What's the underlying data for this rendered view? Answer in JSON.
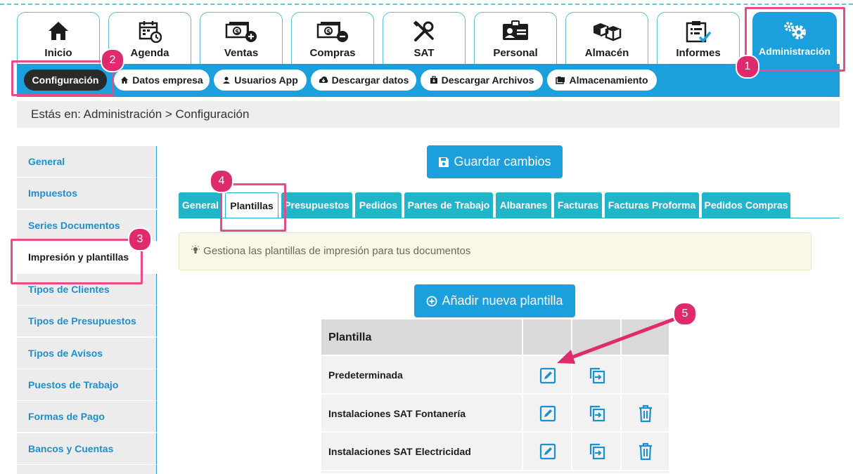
{
  "top_nav": {
    "tabs": [
      {
        "label": "Inicio",
        "icon": "home-icon"
      },
      {
        "label": "Agenda",
        "icon": "calendar-icon"
      },
      {
        "label": "Ventas",
        "icon": "money-plus-icon"
      },
      {
        "label": "Compras",
        "icon": "money-minus-icon"
      },
      {
        "label": "SAT",
        "icon": "tools-icon"
      },
      {
        "label": "Personal",
        "icon": "id-card-icon"
      },
      {
        "label": "Almacén",
        "icon": "boxes-icon"
      },
      {
        "label": "Informes",
        "icon": "clipboard-check-icon"
      },
      {
        "label": "Administración",
        "icon": "gears-icon"
      }
    ],
    "active": "Administración"
  },
  "sub_nav": {
    "items": [
      {
        "label": "Configuración",
        "active": true
      },
      {
        "label": "Datos empresa",
        "icon": "home-icon"
      },
      {
        "label": "Usuarios App",
        "icon": "user-icon"
      },
      {
        "label": "Descargar datos",
        "icon": "cloud-download-icon"
      },
      {
        "label": "Descargar Archivos",
        "icon": "briefcase-download-icon"
      },
      {
        "label": "Almacenamiento",
        "icon": "folders-icon"
      }
    ]
  },
  "breadcrumb": "Estás en: Administración > Configuración",
  "sidebar": {
    "items": [
      {
        "label": "General"
      },
      {
        "label": "Impuestos"
      },
      {
        "label": "Series Documentos"
      },
      {
        "label": "Impresión y plantillas",
        "active": true
      },
      {
        "label": "Tipos de Clientes"
      },
      {
        "label": "Tipos de Presupuestos"
      },
      {
        "label": "Tipos de Avisos"
      },
      {
        "label": "Puestos de Trabajo"
      },
      {
        "label": "Formas de Pago"
      },
      {
        "label": "Bancos y Cuentas"
      }
    ]
  },
  "main": {
    "save_button": "Guardar cambios",
    "tabs": [
      "General",
      "Plantillas",
      "Presupuestos",
      "Pedidos",
      "Partes de Trabajo",
      "Albaranes",
      "Facturas",
      "Facturas Proforma",
      "Pedidos Compras"
    ],
    "active_tab": "Plantillas",
    "info_text": "Gestiona las plantillas de impresión para tus documentos",
    "add_button": "Añadir nueva plantilla",
    "table": {
      "header": "Plantilla",
      "rows": [
        {
          "name": "Predeterminada",
          "deletable": false
        },
        {
          "name": "Instalaciones SAT Fontanería",
          "deletable": true
        },
        {
          "name": "Instalaciones SAT Electricidad",
          "deletable": true
        }
      ]
    }
  },
  "annotations": [
    "1",
    "2",
    "3",
    "4",
    "5"
  ],
  "colors": {
    "primary": "#1b9fdd",
    "tab_teal": "#21b5c9",
    "highlight": "#e84c86",
    "badge": "#e02a6e"
  }
}
